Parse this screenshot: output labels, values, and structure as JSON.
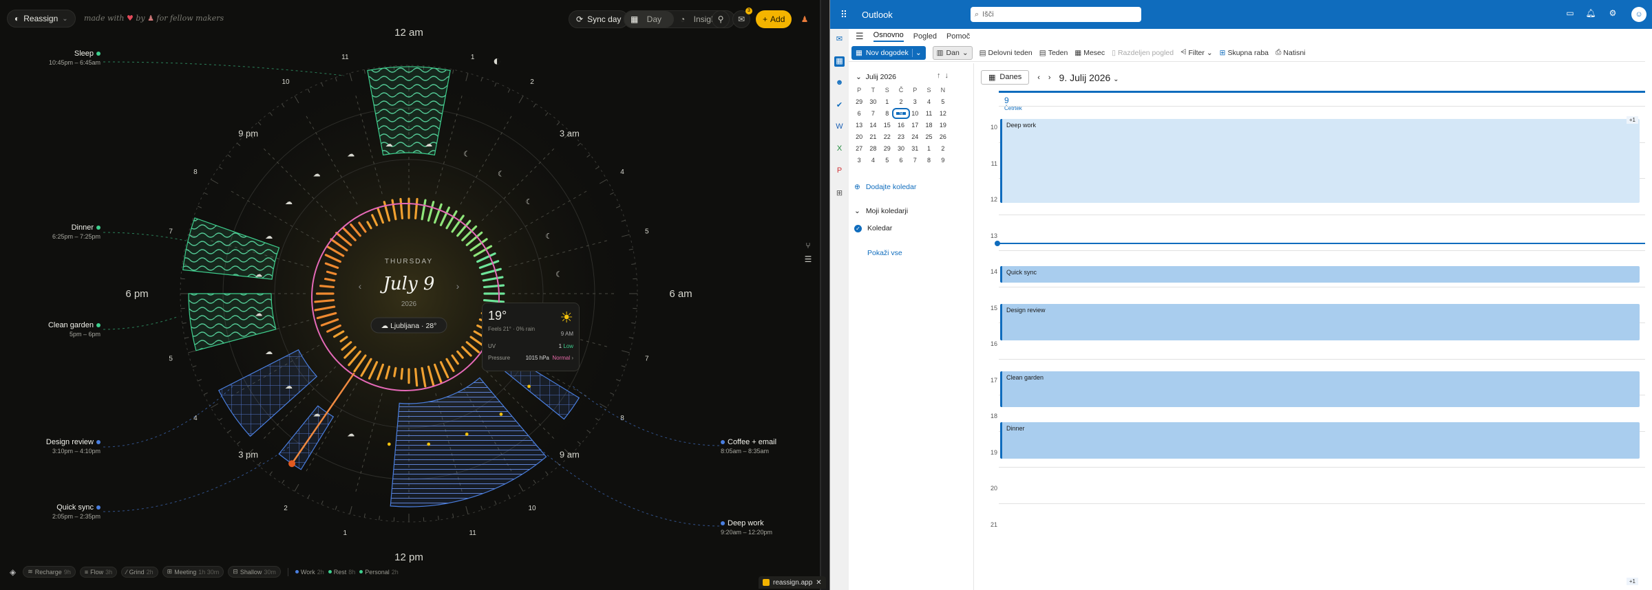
{
  "left_app": {
    "workspace_label": "Reassign",
    "made_with": {
      "prefix": "made with",
      "heart": "♥",
      "by": "by",
      "suffix": "for fellow makers"
    },
    "toolbar": {
      "sync": "Sync day",
      "day": "Day",
      "insights": "Insights",
      "add": "Add",
      "badge": "3"
    },
    "center": {
      "weekday": "THURSDAY",
      "date": "July 9",
      "year": "2026",
      "location": "Ljubljana",
      "loc_temp": "28°"
    },
    "clock_labels": {
      "top": "12 am",
      "bottom": "12 pm",
      "left": "6 pm",
      "right": "6 am",
      "p3am": "3 am",
      "p9am": "9 am",
      "p3pm": "3 pm",
      "p9pm": "9 pm"
    },
    "hour_numbers": [
      "1",
      "2",
      "4",
      "5",
      "7",
      "8",
      "10",
      "11",
      "1",
      "2",
      "4",
      "5",
      "7",
      "8",
      "10",
      "11"
    ],
    "events": [
      {
        "name": "Sleep",
        "time": "10:45pm – 6:45am",
        "color": "#3ecf8e"
      },
      {
        "name": "Dinner",
        "time": "6:25pm – 7:25pm",
        "color": "#3ecf8e"
      },
      {
        "name": "Clean garden",
        "time": "5pm – 6pm",
        "color": "#3ecf8e"
      },
      {
        "name": "Design review",
        "time": "3:10pm – 4:10pm",
        "color": "#4a7fe0"
      },
      {
        "name": "Quick sync",
        "time": "2:05pm – 2:35pm",
        "color": "#4a7fe0"
      },
      {
        "name": "Coffee + email",
        "time": "8:05am – 8:35am",
        "color": "#4a7fe0"
      },
      {
        "name": "Deep work",
        "time": "9:20am – 12:20pm",
        "color": "#4a7fe0"
      }
    ],
    "weather_card": {
      "temp": "19°",
      "feels": "Feels 21° · 0% rain",
      "time": "9 AM",
      "uv_label": "UV",
      "uv_value": "1",
      "uv_level": "Low",
      "pressure_label": "Pressure",
      "pressure_value": "1015 hPa",
      "pressure_level": "Normal"
    },
    "bottom_chips": [
      {
        "label": "Recharge",
        "value": "9h"
      },
      {
        "label": "Flow",
        "value": "3h"
      },
      {
        "label": "Grind",
        "value": "2h"
      },
      {
        "label": "Meeting",
        "value": "1h 30m"
      },
      {
        "label": "Shallow",
        "value": "30m"
      }
    ],
    "legend": [
      {
        "label": "Work",
        "value": "2h",
        "color": "#4a7fe0"
      },
      {
        "label": "Rest",
        "value": "8h",
        "color": "#3ecf8e"
      },
      {
        "label": "Personal",
        "value": "2h",
        "color": "#3ecf8e"
      }
    ],
    "tab_label": "reassign.app"
  },
  "outlook": {
    "brand": "Outlook",
    "search_placeholder": "Išči",
    "menu": [
      "Osnovno",
      "Pogled",
      "Pomoč"
    ],
    "ribbon": {
      "new_event": "Nov dogodek",
      "day": "Dan",
      "work_week": "Delovni teden",
      "week": "Teden",
      "month": "Mesec",
      "split": "Razdeljen pogled",
      "filter": "Filter",
      "share": "Skupna raba",
      "print": "Natisni"
    },
    "mini_cal": {
      "title": "Julij 2026",
      "headers": [
        "P",
        "T",
        "S",
        "Č",
        "P",
        "S",
        "N"
      ],
      "weeks": [
        [
          "29",
          "30",
          "1",
          "2",
          "3",
          "4",
          "5"
        ],
        [
          "6",
          "7",
          "8",
          "9",
          "10",
          "11",
          "12"
        ],
        [
          "13",
          "14",
          "15",
          "16",
          "17",
          "18",
          "19"
        ],
        [
          "20",
          "21",
          "22",
          "23",
          "24",
          "25",
          "26"
        ],
        [
          "27",
          "28",
          "29",
          "30",
          "31",
          "1",
          "2"
        ],
        [
          "3",
          "4",
          "5",
          "6",
          "7",
          "8",
          "9"
        ]
      ]
    },
    "add_calendar": "Dodajte koledar",
    "my_calendars": "Moji koledarji",
    "calendar_item": "Koledar",
    "show_all": "Pokaži vse",
    "today_btn": "Danes",
    "date_title": "9. Julij 2026",
    "day_num": "9",
    "day_name": "Četrtek",
    "hours": [
      "10",
      "11",
      "12",
      "13",
      "14",
      "15",
      "16",
      "17",
      "18",
      "19",
      "20",
      "21"
    ],
    "events": [
      {
        "title": "Deep work"
      },
      {
        "title": "Quick sync"
      },
      {
        "title": "Design review"
      },
      {
        "title": "Clean garden"
      },
      {
        "title": "Dinner"
      }
    ],
    "plus_one": "+1"
  }
}
